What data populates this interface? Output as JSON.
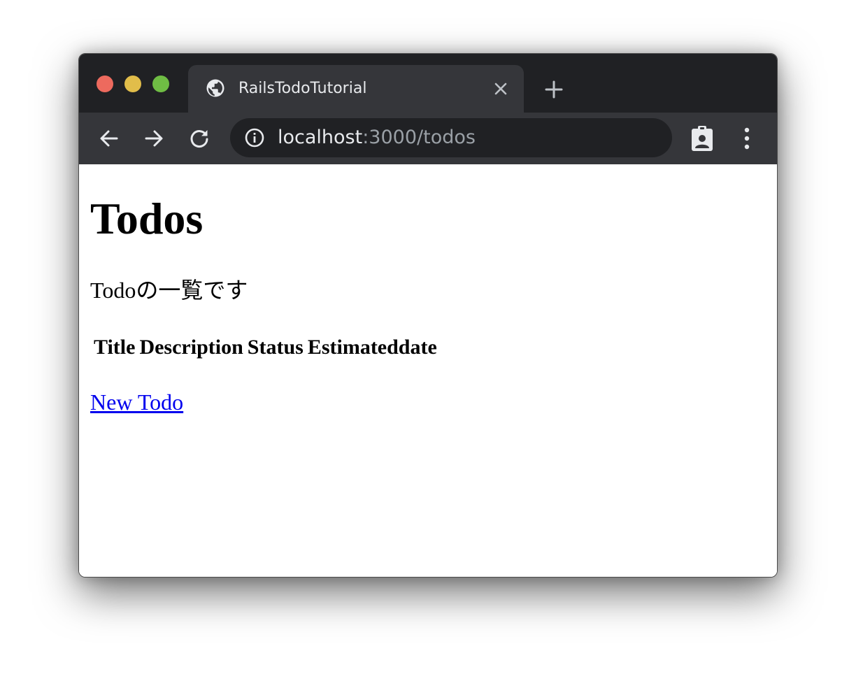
{
  "browser": {
    "tab": {
      "title": "RailsTodoTutorial",
      "favicon": "globe-icon"
    },
    "address_bar": {
      "host": "localhost",
      "rest": ":3000/todos",
      "security_icon": "info-icon"
    },
    "toolbar_icons": [
      "back-arrow-icon",
      "forward-arrow-icon",
      "reload-icon",
      "clipboard-badge-icon",
      "more-vert-icon"
    ],
    "colors": {
      "tabstrip": "#202124",
      "active_tab": "#35363a",
      "omnibox": "#202124",
      "traffic_close": "#ed6a5e",
      "traffic_minimize": "#e1bd4a",
      "traffic_maximize": "#6fbd44",
      "link": "#0000ee"
    }
  },
  "page": {
    "title": "Todos",
    "description": "Todoの一覧です",
    "table": {
      "headers": [
        "Title",
        "Description",
        "Status",
        "Estimateddate"
      ],
      "rows": []
    },
    "new_link": "New Todo"
  }
}
